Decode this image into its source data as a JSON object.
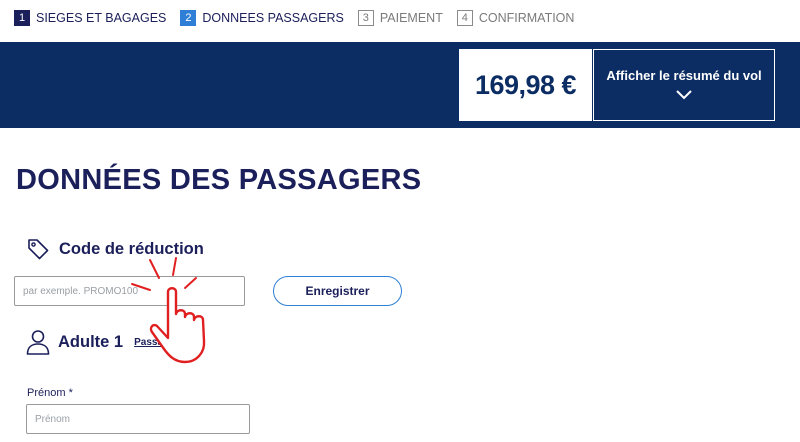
{
  "steps": [
    {
      "number": "1",
      "label": "SIEGES ET BAGAGES",
      "state": "done"
    },
    {
      "number": "2",
      "label": "DONNEES PASSAGERS",
      "state": "active"
    },
    {
      "number": "3",
      "label": "PAIEMENT",
      "state": "pending"
    },
    {
      "number": "4",
      "label": "CONFIRMATION",
      "state": "pending"
    }
  ],
  "banner": {
    "price": "169,98 €",
    "summary_label": "Afficher le résumé du vol",
    "chevron_icon": "chevron-down-icon"
  },
  "page": {
    "title": "DONNÉES DES PASSAGERS"
  },
  "discount": {
    "icon": "tag-icon",
    "title": "Code de réduction",
    "input_placeholder": "par exemple. PROMO100",
    "button_label": "Enregistrer"
  },
  "adult": {
    "icon": "person-icon",
    "title": "Adulte 1",
    "passenger_link": "Passager"
  },
  "firstname": {
    "label": "Prénom *",
    "placeholder": "Prénom"
  },
  "colors": {
    "navy": "#0c2d63",
    "text_dark": "#1b1f5a",
    "accent_blue": "#2f7fd6",
    "hand_red": "#e02020"
  },
  "overlay": {
    "icon": "hand-pointer-icon"
  }
}
